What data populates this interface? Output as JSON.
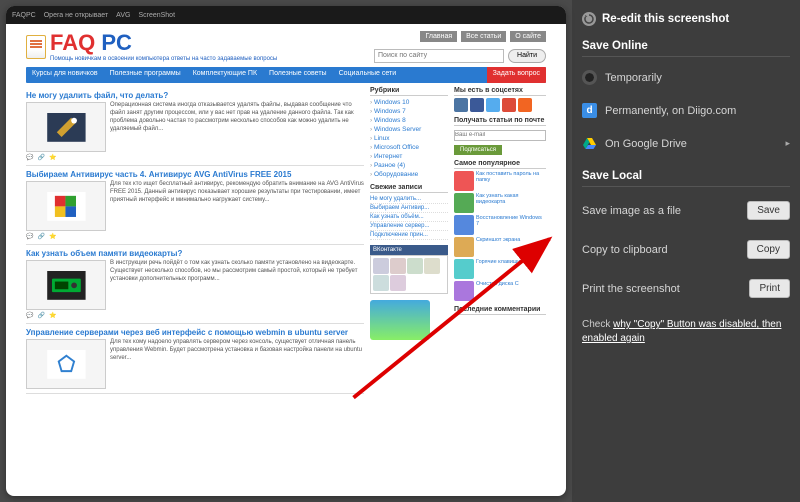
{
  "topbar": {
    "tabs": [
      "FAQPC",
      "Opera не открывает",
      "AVG",
      "ScreenShot"
    ]
  },
  "header": {
    "logo_faq": "FAQ",
    "logo_pc": " PC",
    "logo_sub": "Помощь новичкам в освоении компьютера\nответы на часто задаваемые вопросы",
    "top_links": [
      "Главная",
      "Все статьи",
      "О сайте"
    ],
    "search_placeholder": "Поиск по сайту",
    "search_btn": "Найти"
  },
  "nav": [
    "Курсы для новичков",
    "Полезные программы",
    "Комплектующие ПК",
    "Полезные советы",
    "Социальные сети",
    "Задать вопрос"
  ],
  "posts": [
    {
      "title": "Не могу удалить файл, что делать?",
      "text": "Операционная система иногда отказывается удалять файлы, выдавая сообщение что файл занят другим процессом, или у вас нет прав на удаление данного файла. Так как проблема довольно частая то рассмотрим несколько способов как можно удалить не удаляемый файл..."
    },
    {
      "title": "Выбираем Антивирус часть 4. Антивирус AVG AntiVirus FREE 2015",
      "text": "Для тех кто ищет бесплатный антивирус, рекомендую обратить внимание на AVG AntiVirus FREE 2015. Данный антивирус показывает хорошие результаты при тестировании, имеет приятный интерфейс и минимально нагружает систему..."
    },
    {
      "title": "Как узнать объем памяти видеокарты?",
      "text": "В инструкции речь пойдёт о том как узнать сколько памяти установлено на видеокарте. Существует несколько способов, но мы рассмотрим самый простой, который не требует установки дополнительных программ..."
    },
    {
      "title": "Управление серверами через веб интерфейс с помощью webmin в ubuntu server",
      "text": "Для тех кому надоело управлять сервером через консоль, существует отличная панель управления Webmin. Будет рассмотрена установка и базовая настройка панели на ubuntu server..."
    }
  ],
  "sidemid": {
    "rubrics_h": "Рубрики",
    "rubrics": [
      "Windows 10",
      "Windows 7",
      "Windows 8",
      "Windows Server",
      "Linux",
      "Microsoft Office",
      "Интернет",
      "Разное (4)",
      "Оборудование"
    ],
    "recent_h": "Свежие записи",
    "recent": [
      "Не могу удалить...",
      "Выбираем Антивир...",
      "Как узнать объём...",
      "Управление сервер...",
      "Подключение прин..."
    ],
    "more_h": "——"
  },
  "sideright": {
    "social_h": "Мы есть в соцсетях",
    "email_h": "Получать статьи по почте",
    "email_ph": "Ваш e-mail",
    "email_btn": "Подписаться",
    "popular_h": "Самое популярное",
    "popular": [
      "Как поставить пароль на папку",
      "Как узнать какая видеокарта",
      "Восстановление Windows 7",
      "Скриншот экрана",
      "Горячие клавиши",
      "Очистка диска C"
    ],
    "comments_h": "Последние комментарии"
  },
  "panel": {
    "reedit": "Re-edit this screenshot",
    "save_online_h": "Save Online",
    "opt_temp": "Temporarily",
    "opt_diigo": "Permanently, on Diigo.com",
    "opt_gdrive": "On Google Drive",
    "save_local_h": "Save Local",
    "save_file": "Save image as a file",
    "save_btn": "Save",
    "copy_clip": "Copy to clipboard",
    "copy_btn": "Copy",
    "print": "Print the screenshot",
    "print_btn": "Print",
    "check_pre": "Check ",
    "check_link": "why \"Copy\" Button was disabled, then enabled again"
  }
}
